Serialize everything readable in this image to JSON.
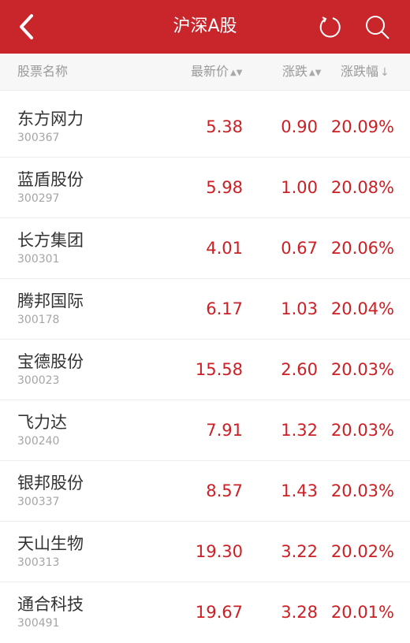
{
  "header": {
    "title": "沪深A股",
    "icons": [
      "back-arrow-icon",
      "refresh-icon",
      "search-icon"
    ],
    "background": "#c9262c"
  },
  "columns": {
    "name": "股票名称",
    "price": "最新价",
    "change": "涨跌",
    "percent": "涨跌幅",
    "price_sort": "▲▼",
    "change_sort": "▲▼",
    "percent_sort": "↓"
  },
  "colors": {
    "rise": "#cc1f24",
    "label": "#9a9a9a"
  },
  "stocks": [
    {
      "name": "东方网力",
      "code": "300367",
      "price": "5.38",
      "change": "0.90",
      "percent": "20.09%"
    },
    {
      "name": "蓝盾股份",
      "code": "300297",
      "price": "5.98",
      "change": "1.00",
      "percent": "20.08%"
    },
    {
      "name": "长方集团",
      "code": "300301",
      "price": "4.01",
      "change": "0.67",
      "percent": "20.06%"
    },
    {
      "name": "腾邦国际",
      "code": "300178",
      "price": "6.17",
      "change": "1.03",
      "percent": "20.04%"
    },
    {
      "name": "宝德股份",
      "code": "300023",
      "price": "15.58",
      "change": "2.60",
      "percent": "20.03%"
    },
    {
      "name": "飞力达",
      "code": "300240",
      "price": "7.91",
      "change": "1.32",
      "percent": "20.03%"
    },
    {
      "name": "银邦股份",
      "code": "300337",
      "price": "8.57",
      "change": "1.43",
      "percent": "20.03%"
    },
    {
      "name": "天山生物",
      "code": "300313",
      "price": "19.30",
      "change": "3.22",
      "percent": "20.02%"
    },
    {
      "name": "通合科技",
      "code": "300491",
      "price": "19.67",
      "change": "3.28",
      "percent": "20.01%"
    }
  ]
}
